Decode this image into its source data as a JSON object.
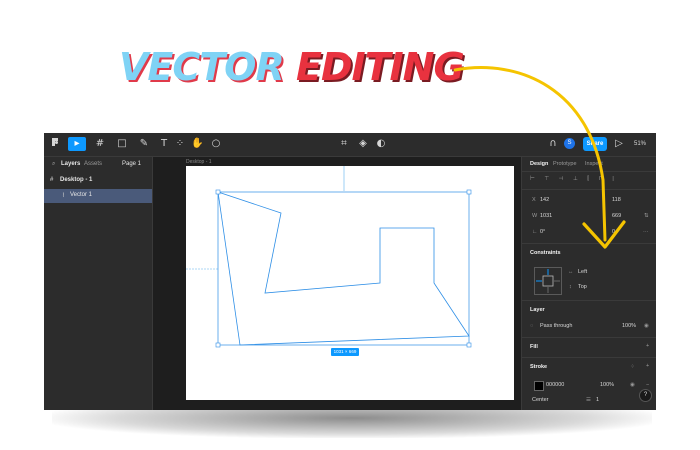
{
  "headline": {
    "word1": "VECTOR",
    "word2": "EDITING"
  },
  "colors": {
    "accent": "#0d99ff",
    "arrow": "#f5c400",
    "headline_blue": "#7fd3f5",
    "headline_red": "#e8323f"
  },
  "toolbar": {
    "icons": [
      "figma-menu-icon",
      "move-tool-icon",
      "frame-tool-icon",
      "shape-tool-icon",
      "pen-tool-icon",
      "text-tool-icon",
      "component-icon",
      "hand-tool-icon",
      "comment-icon",
      "crop-icon",
      "fill-icon",
      "contrast-icon",
      "headphones-icon",
      "play-icon"
    ],
    "avatar": "S",
    "share_label": "Share",
    "zoom": "51%"
  },
  "left_panel": {
    "tabs": [
      "Layers",
      "Assets"
    ],
    "page": "Page 1",
    "layers": [
      {
        "name": "Desktop - 1"
      },
      {
        "name": "Vector 1"
      }
    ]
  },
  "canvas": {
    "frame_label": "Desktop - 1",
    "dimensions": "1031 × 669"
  },
  "right_panel": {
    "tabs": [
      "Design",
      "Prototype",
      "Inspect"
    ],
    "x_label": "X",
    "x_value": "142",
    "y_value": "118",
    "w_label": "W",
    "w_value": "1031",
    "h_value": "669",
    "rotation": "0°",
    "radius": "0",
    "constraints_title": "Constraints",
    "constraint_h": "Left",
    "constraint_v": "Top",
    "layer_title": "Layer",
    "blend": "Pass through",
    "opacity": "100%",
    "fill_title": "Fill",
    "stroke_title": "Stroke",
    "stroke_color": "000000",
    "stroke_opacity": "100%",
    "stroke_align": "Center",
    "stroke_weight": "1",
    "help": "?"
  }
}
